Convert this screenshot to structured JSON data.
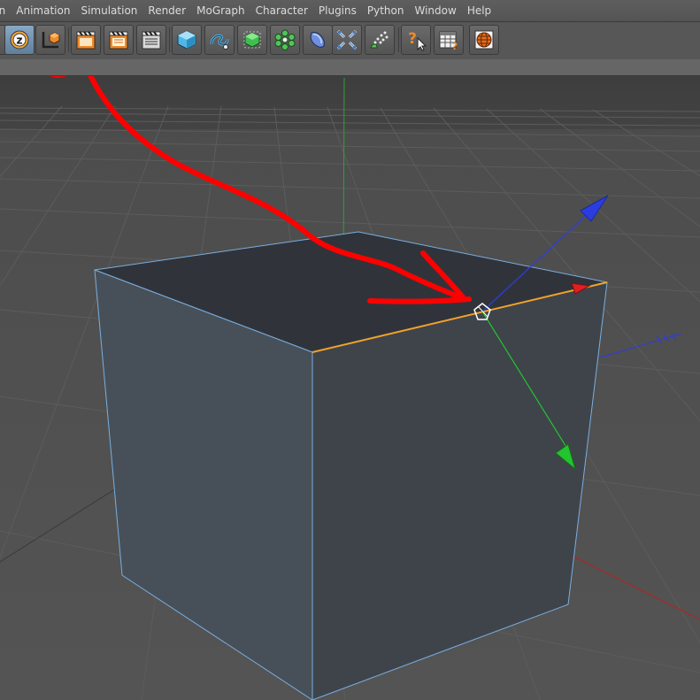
{
  "menubar": {
    "items": [
      "ion",
      "Animation",
      "Simulation",
      "Render",
      "MoGraph",
      "Character",
      "Plugins",
      "Python",
      "Window",
      "Help"
    ]
  },
  "toolbar": {
    "buttons": [
      {
        "icon": "world-coordinate-z-icon",
        "active": true
      },
      {
        "icon": "object-axis-icon"
      },
      {
        "icon": "render-view-icon"
      },
      {
        "icon": "render-picture-viewer-icon"
      },
      {
        "icon": "render-settings-icon"
      },
      {
        "icon": "cube-object-icon"
      },
      {
        "icon": "spline-pen-icon"
      },
      {
        "icon": "subdivision-surface-icon"
      },
      {
        "icon": "array-object-icon"
      },
      {
        "icon": "deformer-icon"
      },
      {
        "icon": "scene-environment-icon"
      },
      {
        "icon": "particle-emitter-icon"
      },
      {
        "icon": "help-pointer-icon"
      },
      {
        "icon": "layout-table-icon"
      },
      {
        "icon": "globe-icon"
      }
    ]
  },
  "colors": {
    "menubar_bg": "#5a5a5a",
    "toolbar_bg": "#575757",
    "cube_face": "#3f444b",
    "cube_top": "#30343a",
    "selected_edge": "#f2a22a",
    "x_axis": "#e02020",
    "y_axis": "#22c52f",
    "z_axis": "#2c3de0",
    "annotation": "#ff0000"
  }
}
